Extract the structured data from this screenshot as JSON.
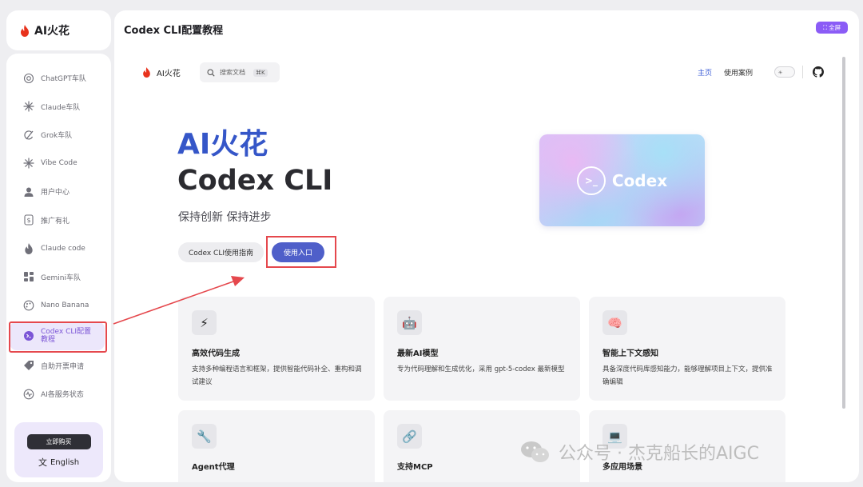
{
  "app": {
    "brand": "AI火花"
  },
  "sidebar": {
    "items": [
      {
        "label": "ChatGPT车队",
        "icon": "openai-icon"
      },
      {
        "label": "Claude车队",
        "icon": "claude-icon"
      },
      {
        "label": "Grok车队",
        "icon": "grok-icon"
      },
      {
        "label": "Vibe Code",
        "icon": "vibe-icon"
      },
      {
        "label": "用户中心",
        "icon": "user-icon"
      },
      {
        "label": "推广有礼",
        "icon": "dollar-icon"
      },
      {
        "label": "Claude code",
        "icon": "flame-icon"
      },
      {
        "label": "Gemini车队",
        "icon": "grid-icon"
      },
      {
        "label": "Nano Banana",
        "icon": "palette-icon"
      },
      {
        "label": "Codex CLI配置教程",
        "icon": "codex-icon",
        "active": true
      },
      {
        "label": "自助开票申请",
        "icon": "tag-icon"
      },
      {
        "label": "AI各服务状态",
        "icon": "pulse-icon"
      }
    ],
    "buy_label": "立即购买",
    "lang_label": "English"
  },
  "panel": {
    "title": "Codex CLI配置教程",
    "fullscreen_label": "全屏"
  },
  "docs": {
    "logo_text": "AI火花",
    "search_placeholder": "搜索文档",
    "search_shortcut": "⌘K",
    "nav_home": "主页",
    "nav_cases": "使用案例"
  },
  "hero": {
    "brand": "AI火花",
    "title": "Codex CLI",
    "tagline": "保持创新 保持进步",
    "btn_guide": "Codex CLI使用指南",
    "btn_enter": "使用入口",
    "card_text": "Codex",
    "card_icon_glyph": ">_"
  },
  "features": [
    {
      "icon": "lightning-icon",
      "glyph": "⚡",
      "title": "高效代码生成",
      "desc": "支持多种编程语言和框架，提供智能代码补全、重构和调试建议"
    },
    {
      "icon": "robot-icon",
      "glyph": "🤖",
      "title": "最新AI模型",
      "desc": "专为代码理解和生成优化，采用 gpt-5-codex 最新模型"
    },
    {
      "icon": "brain-icon",
      "glyph": "🧠",
      "title": "智能上下文感知",
      "desc": "具备深度代码库感知能力，能够理解项目上下文，提供准确编辑"
    },
    {
      "icon": "wrench-icon",
      "glyph": "🔧",
      "title": "Agent代理",
      "desc": ""
    },
    {
      "icon": "link-icon",
      "glyph": "🔗",
      "title": "支持MCP",
      "desc": ""
    },
    {
      "icon": "laptop-icon",
      "glyph": "💻",
      "title": "多应用场景",
      "desc": ""
    }
  ],
  "watermark": {
    "text": "公众号 · 杰克船长的AIGC"
  },
  "colors": {
    "accent": "#3556c8",
    "enter_button": "#4f5fc9",
    "fullscreen": "#8b5cf6",
    "active_nav_bg": "#ece7fb",
    "annotation_red": "#e5484d"
  }
}
